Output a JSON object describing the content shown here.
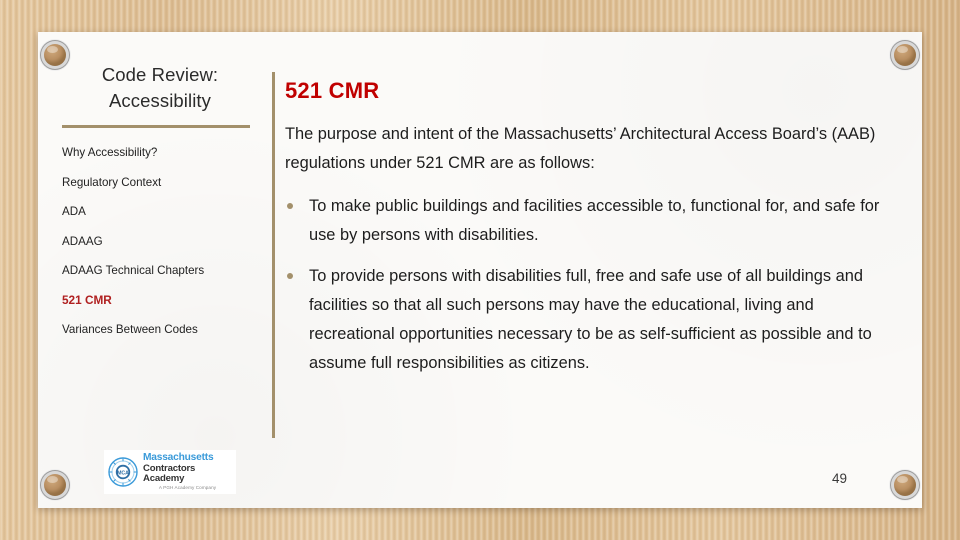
{
  "slide": {
    "page_number": "49"
  },
  "sidebar": {
    "deck_title_line1": "Code Review:",
    "deck_title_line2": "Accessibility",
    "items": [
      {
        "label": "Why Accessibility?",
        "active": false
      },
      {
        "label": "Regulatory Context",
        "active": false
      },
      {
        "label": "ADA",
        "active": false
      },
      {
        "label": "ADAAG",
        "active": false
      },
      {
        "label": "ADAAG Technical Chapters",
        "active": false
      },
      {
        "label": "521 CMR",
        "active": true
      },
      {
        "label": "Variances Between Codes",
        "active": false
      }
    ]
  },
  "content": {
    "heading": "521 CMR",
    "lede": "The purpose and intent of the Massachusetts’ Architectural Access Board’s (AAB) regulations under 521 CMR are as follows:",
    "bullets": [
      "To make public buildings and facilities accessible to, functional for, and safe for use by persons with disabilities.",
      "To provide persons with disabilities full, free and safe use of all buildings and facilities so that all such persons may have the educational, living and recreational opportunities necessary to be as self-sufficient as possible and to assume full responsibilities as citizens."
    ]
  },
  "logo": {
    "line1": "Massachusetts",
    "line2": "Contractors Academy",
    "tagline": "A PGH Academy Company"
  },
  "colors": {
    "accent_red": "#C00000",
    "sidebar_active_red": "#B02020",
    "rule_tan": "#A3906B",
    "wood_background": "#D8B98C",
    "panel_white": "#FBFAF8",
    "logo_blue": "#3A9AD9"
  }
}
